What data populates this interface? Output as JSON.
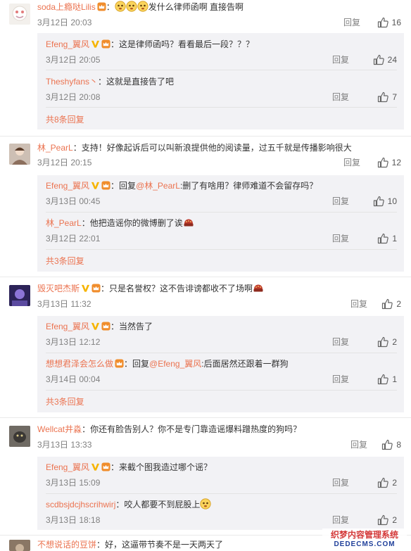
{
  "accent_color": "#eb7350",
  "icons": {
    "like": "thumbs-up-icon",
    "verified": "verified-v-icon",
    "member": "vip-crown-icon"
  },
  "threads": [
    {
      "user": "soda上瘾哒Lilis",
      "text_before": "：",
      "text": "发什么律师函啊 直接告啊",
      "time": "3月12日 20:03",
      "reply": "回复",
      "likes": "16",
      "subs": [
        {
          "user": "Efeng_翼风",
          "text": "：这是律师函吗？看看最后一段？？？",
          "time": "3月12日 20:05",
          "reply": "回复",
          "likes": "24"
        },
        {
          "user": "Theshyfans丶",
          "text": "：这就是直接告了吧",
          "time": "3月12日 20:08",
          "reply": "回复",
          "likes": "7"
        }
      ],
      "more": "共8条回复"
    },
    {
      "user": "林_PearL",
      "text": "：支持！好像起诉后可以叫新浪提供他的阅读量，过五千就是传播影响很大",
      "time": "3月12日 20:15",
      "reply": "回复",
      "likes": "12",
      "subs": [
        {
          "user": "Efeng_翼风",
          "text_pre": "：回复",
          "mention": "@林_PearL",
          "text": ":删了有啥用？律师难道不会留存吗？",
          "time": "3月13日 00:45",
          "reply": "回复",
          "likes": "10"
        },
        {
          "user": "林_PearL",
          "text": "：他把造谣你的微博删了诶",
          "time": "3月12日 22:01",
          "reply": "回复",
          "likes": "1"
        }
      ],
      "more": "共3条回复"
    },
    {
      "user": "毁灭吧杰斯",
      "text": "：只是名誉权？这不告诽谤都收不了场啊",
      "time": "3月13日 11:32",
      "reply": "回复",
      "likes": "2",
      "subs": [
        {
          "user": "Efeng_翼风",
          "text": "：当然告了",
          "time": "3月13日 12:12",
          "reply": "回复",
          "likes": "2"
        },
        {
          "user": "想想君泽会怎么做",
          "text_pre": "：回复",
          "mention": "@Efeng_翼风",
          "text": ":后面居然还跟着一群狗",
          "time": "3月14日 00:04",
          "reply": "回复",
          "likes": "1"
        }
      ],
      "more": "共3条回复"
    },
    {
      "user": "Wellcat井淼",
      "text": "：你还有脸告别人？你不是专门靠造谣爆料蹭热度的狗吗？",
      "time": "3月13日 13:33",
      "reply": "回复",
      "likes": "8",
      "subs": [
        {
          "user": "Efeng_翼风",
          "text": "：来截个图我造过哪个谣？",
          "time": "3月13日 15:09",
          "reply": "回复",
          "likes": "2"
        },
        {
          "user": "scdbsjdcjhscrihwirj",
          "text": "：咬人都要不到屁股上",
          "time": "3月13日 18:18",
          "reply": "回复",
          "likes": "2"
        }
      ]
    },
    {
      "user": "不想说话的豆饼",
      "text": "：好，这逼带节奏不是一天两天了"
    }
  ],
  "watermark": {
    "line1": "织梦内容管理系统",
    "line2": "DEDECMS.COM"
  }
}
